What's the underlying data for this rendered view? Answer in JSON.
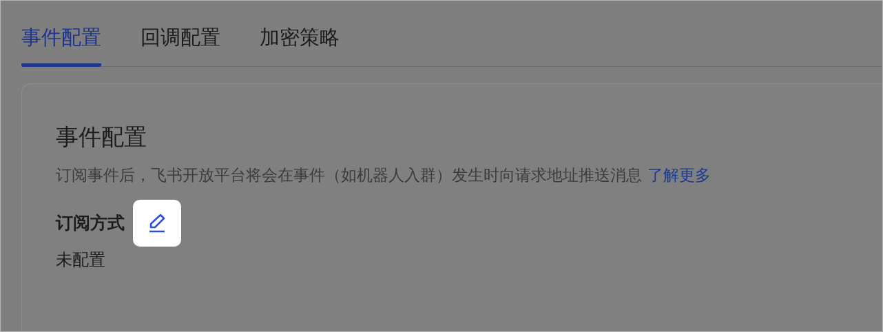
{
  "tabs": [
    {
      "label": "事件配置",
      "selected": true
    },
    {
      "label": "回调配置",
      "selected": false
    },
    {
      "label": "加密策略",
      "selected": false
    }
  ],
  "card": {
    "title": "事件配置",
    "description": "订阅事件后，飞书开放平台将会在事件（如机器人入群）发生时向请求地址推送消息",
    "link": "了解更多",
    "section": {
      "label": "订阅方式",
      "value": "未配置"
    }
  }
}
